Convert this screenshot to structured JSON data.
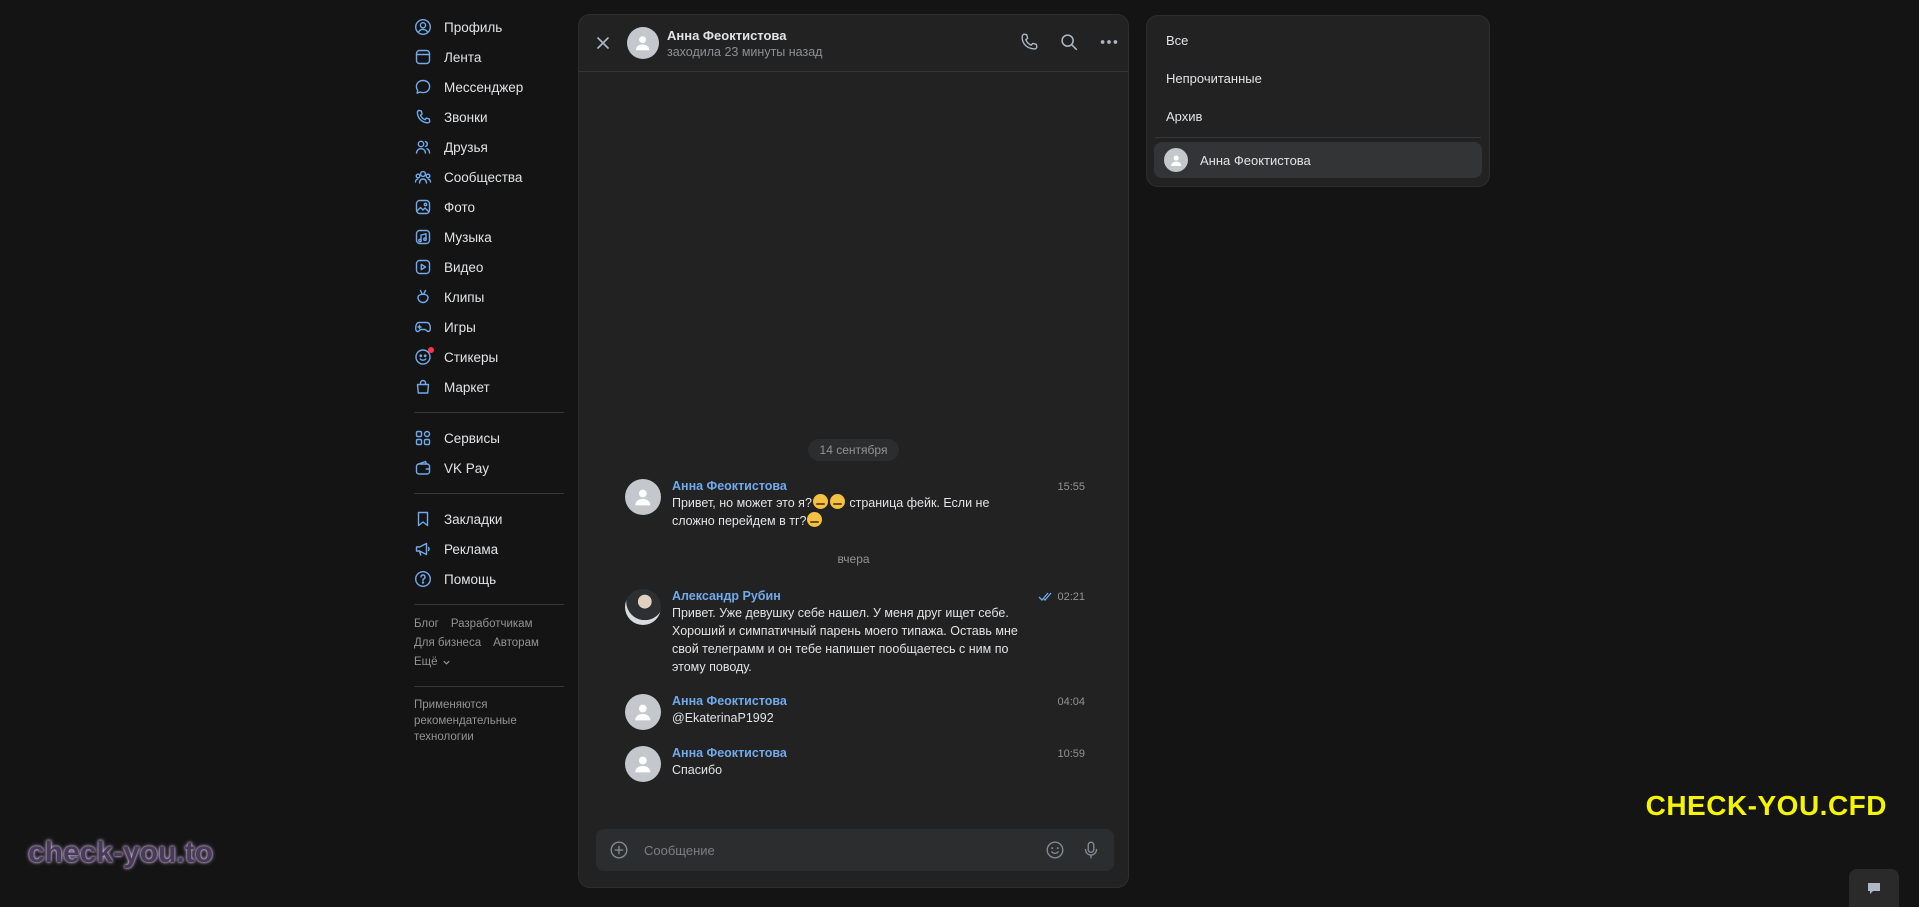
{
  "nav": {
    "items": [
      {
        "label": "Профиль",
        "icon": "user-circle-icon"
      },
      {
        "label": "Лента",
        "icon": "feed-icon"
      },
      {
        "label": "Мессенджер",
        "icon": "message-icon"
      },
      {
        "label": "Звонки",
        "icon": "phone-icon"
      },
      {
        "label": "Друзья",
        "icon": "friends-icon"
      },
      {
        "label": "Сообщества",
        "icon": "communities-icon"
      },
      {
        "label": "Фото",
        "icon": "photo-icon"
      },
      {
        "label": "Музыка",
        "icon": "music-icon"
      },
      {
        "label": "Видео",
        "icon": "video-icon"
      },
      {
        "label": "Клипы",
        "icon": "clips-icon"
      },
      {
        "label": "Игры",
        "icon": "gamepad-icon"
      },
      {
        "label": "Стикеры",
        "icon": "sticker-icon"
      },
      {
        "label": "Маркет",
        "icon": "market-bag-icon"
      }
    ],
    "items2": [
      {
        "label": "Сервисы",
        "icon": "services-icon"
      },
      {
        "label": "VK Pay",
        "icon": "wallet-icon"
      }
    ],
    "items3": [
      {
        "label": "Закладки",
        "icon": "bookmark-icon"
      },
      {
        "label": "Реклама",
        "icon": "megaphone-icon"
      },
      {
        "label": "Помощь",
        "icon": "help-icon"
      }
    ],
    "footer": {
      "blog": "Блог",
      "dev": "Разработчикам",
      "business": "Для бизнеса",
      "authors": "Авторам",
      "more": "Ещё"
    },
    "rec_note": "Применяются рекомендательные технологии"
  },
  "chat": {
    "name": "Анна Феоктистова",
    "status": "заходила 23 минуты назад",
    "date_chip": "14 сентября",
    "day_label": "вчера",
    "messages": [
      {
        "author": "Анна Феоктистова",
        "time": "15:55",
        "text_a": "Привет, но может это я?",
        "text_b": " страница фейк. Если не сложно перейдем в тг?"
      },
      {
        "author": "Александр Рубин",
        "time": "02:21",
        "text": "Привет. Уже девушку себе нашел. У меня друг ищет себе. Хороший и симпатичный парень моего типажа. Оставь мне свой телеграмм и он тебе напишет пообщаетесь с ним по этому поводу."
      },
      {
        "author": "Анна Феоктистова",
        "time": "04:04",
        "text": "@EkaterinaP1992"
      },
      {
        "author": "Анна Феоктистова",
        "time": "10:59",
        "text": "Спасибо"
      }
    ],
    "composer_placeholder": "Сообщение"
  },
  "filters": {
    "all": "Все",
    "unread": "Непрочитанные",
    "archive": "Архив"
  },
  "conversation": {
    "name": "Анна Феоктистова"
  },
  "watermarks": {
    "left": "check-you.to",
    "right": "CHECK-YOU.CFD"
  },
  "colors": {
    "accent": "#71aaeb",
    "background": "#141414",
    "panel": "#222222",
    "watermark_yellow": "#f5f500"
  }
}
